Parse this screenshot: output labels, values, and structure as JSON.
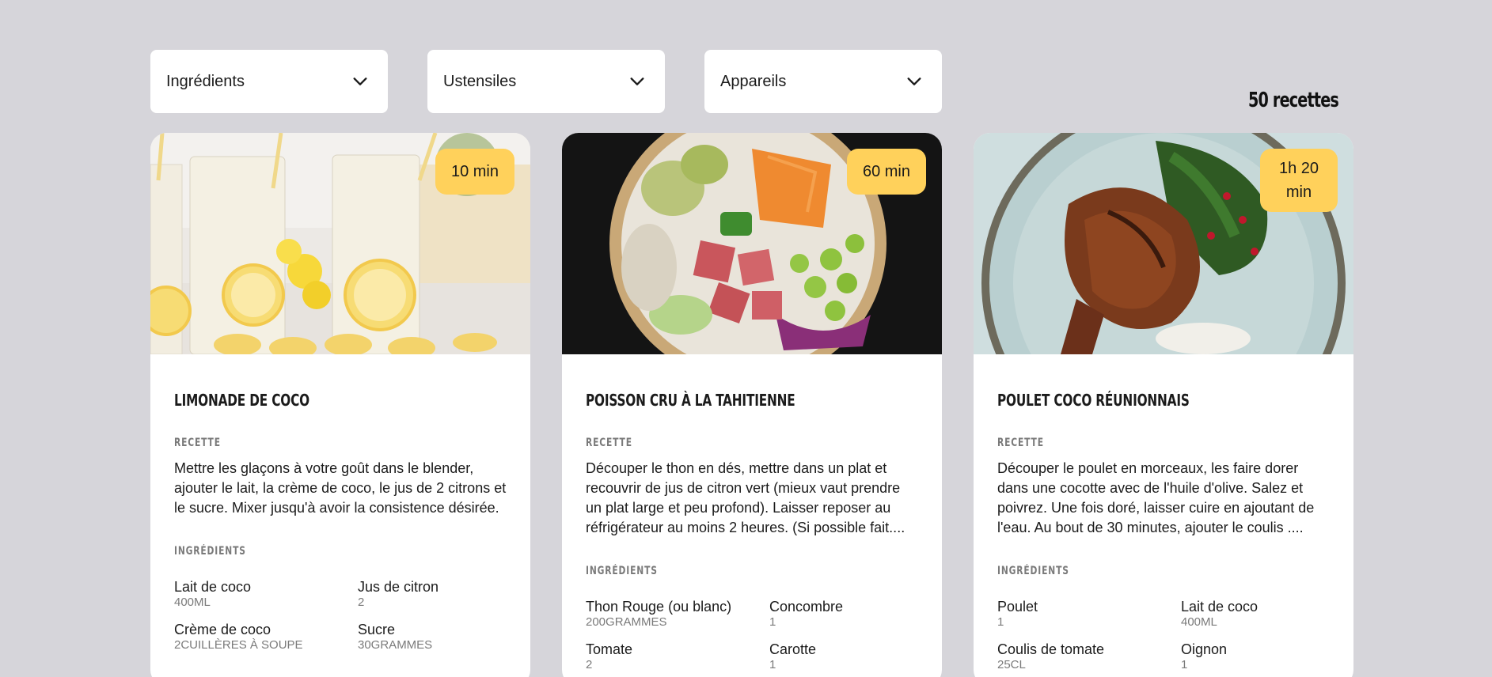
{
  "filters": [
    {
      "label": "Ingrédients",
      "icon": "chevron-down-icon"
    },
    {
      "label": "Ustensiles",
      "icon": "chevron-down-icon"
    },
    {
      "label": "Appareils",
      "icon": "chevron-down-icon"
    }
  ],
  "recipe_count": "50 recettes",
  "colors": {
    "background": "#d6d5da",
    "badge": "#ffd15b",
    "card": "#ffffff"
  },
  "recipes": [
    {
      "title": "Limonade de Coco",
      "time": "10 min",
      "recipe_label": "Recette",
      "description": "Mettre les glaçons à votre goût dans le blender, ajouter le lait, la crème de coco, le jus de 2 citrons et le sucre. Mixer jusqu'à avoir la consistence désirée.",
      "ingredients_label": "Ingrédients",
      "ingredients": [
        {
          "name": "Lait de coco",
          "qty": "400ml"
        },
        {
          "name": "Jus de citron",
          "qty": "2"
        },
        {
          "name": "Crème de coco",
          "qty": "2cuillères à soupe"
        },
        {
          "name": "Sucre",
          "qty": "30grammes"
        }
      ]
    },
    {
      "title": "Poisson Cru à la tahitienne",
      "time": "60 min",
      "recipe_label": "Recette",
      "description": "Découper le thon en dés, mettre dans un plat et recouvrir de jus de citron vert (mieux vaut prendre un plat large et peu profond). Laisser reposer au réfrigérateur au moins 2 heures. (Si possible fait....",
      "ingredients_label": "Ingrédients",
      "ingredients": [
        {
          "name": "Thon Rouge (ou blanc)",
          "qty": "200grammes"
        },
        {
          "name": "Concombre",
          "qty": "1"
        },
        {
          "name": "Tomate",
          "qty": "2"
        },
        {
          "name": "Carotte",
          "qty": "1"
        }
      ]
    },
    {
      "title": "Poulet coco réunionnais",
      "time": "1h 20 min",
      "recipe_label": "Recette",
      "description": "Découper le poulet en morceaux, les faire dorer dans une cocotte avec de l'huile d'olive. Salez et poivrez. Une fois doré, laisser cuire en ajoutant de l'eau. Au bout de 30 minutes, ajouter le coulis ....",
      "ingredients_label": "Ingrédients",
      "ingredients": [
        {
          "name": "Poulet",
          "qty": "1"
        },
        {
          "name": "Lait de coco",
          "qty": "400ml"
        },
        {
          "name": "Coulis de tomate",
          "qty": "25cl"
        },
        {
          "name": "Oignon",
          "qty": "1"
        }
      ]
    }
  ]
}
